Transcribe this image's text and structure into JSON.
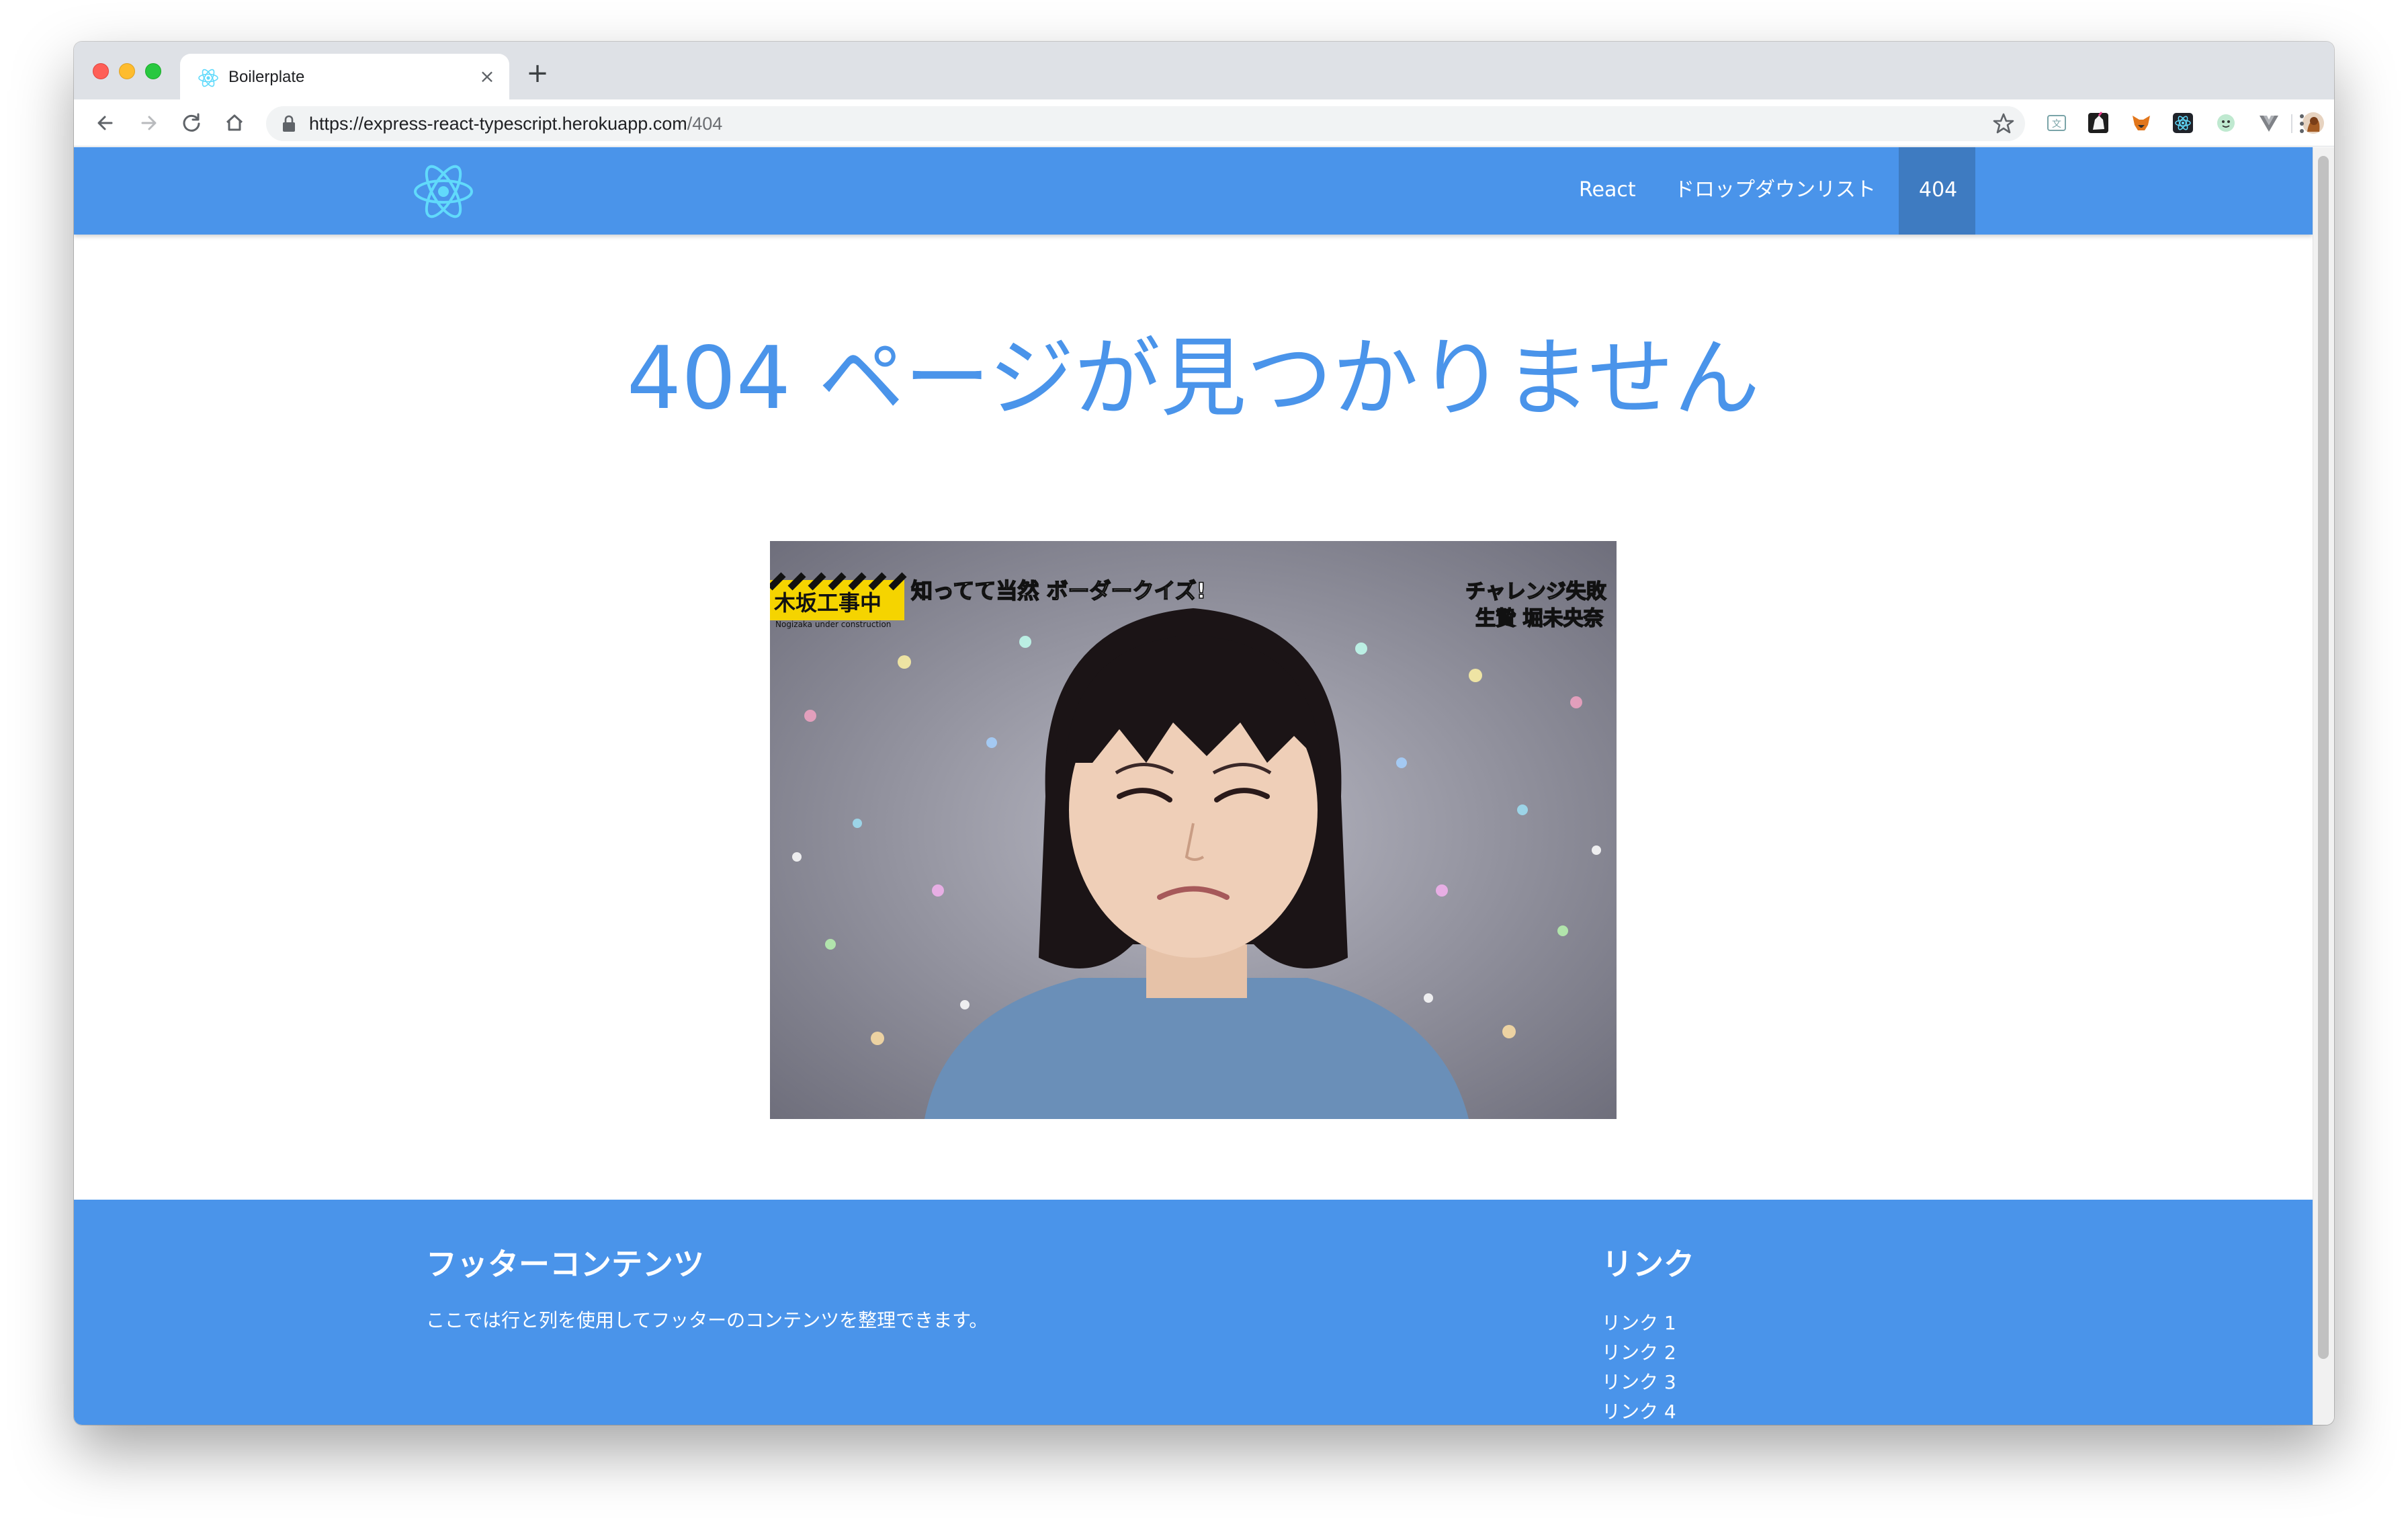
{
  "browser": {
    "tab": {
      "title": "Boilerplate",
      "close_glyph": "×",
      "icon": "react-icon"
    },
    "new_tab_glyph": "+",
    "address": {
      "host": "https://express-react-typescript.herokuapp.com",
      "path": "/404"
    },
    "extensions": [
      "translate-icon",
      "unicorn-icon",
      "metamask-fox-icon",
      "react-devtools-icon",
      "ghost-icon",
      "vue-devtools-icon",
      "profile-avatar"
    ]
  },
  "site": {
    "brand_icon": "react-logo-icon",
    "nav": {
      "react": "React",
      "dropdown": "ドロップダウンリスト",
      "active": "404"
    },
    "heading": "404 ページが見つかりません",
    "image": {
      "caption_left": "知ってて当然 ボーダークイズ!",
      "banner_left": "木坂工事中",
      "banner_left_sub": "Nogizaka under construction",
      "caption_right_1": "チャレンジ失敗",
      "caption_right_2": "生贄 堀未央奈"
    },
    "footer": {
      "title": "フッターコンテンツ",
      "text": "ここでは行と列を使用してフッターのコンテンツを整理できます。",
      "links_title": "リンク",
      "links": [
        "リンク 1",
        "リンク 2",
        "リンク 3",
        "リンク 4"
      ]
    }
  },
  "colors": {
    "primary": "#4a94ea",
    "nav_active": "#3e7bc1",
    "heading": "#4a94ea"
  }
}
